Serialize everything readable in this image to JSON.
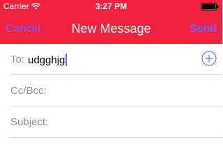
{
  "status_bar": {
    "carrier": "Carrier",
    "time": "3:27 PM",
    "wifi_icon": "wifi-icon",
    "battery_icon": "battery-icon"
  },
  "nav": {
    "cancel_label": "Cancel",
    "title": "New Message",
    "send_label": "Send"
  },
  "fields": {
    "to": {
      "label": "To:",
      "value": "udgghjg",
      "add_icon": "plus-circle-icon"
    },
    "cc_bcc": {
      "label": "Cc/Bcc:",
      "value": ""
    },
    "subject": {
      "label": "Subject:",
      "value": ""
    }
  },
  "colors": {
    "header_bg": "#f2213f",
    "nav_button": "#7b5cff",
    "accent": "#5a78ff",
    "label_gray": "#8e8e93",
    "divider": "#d8d8d8"
  }
}
